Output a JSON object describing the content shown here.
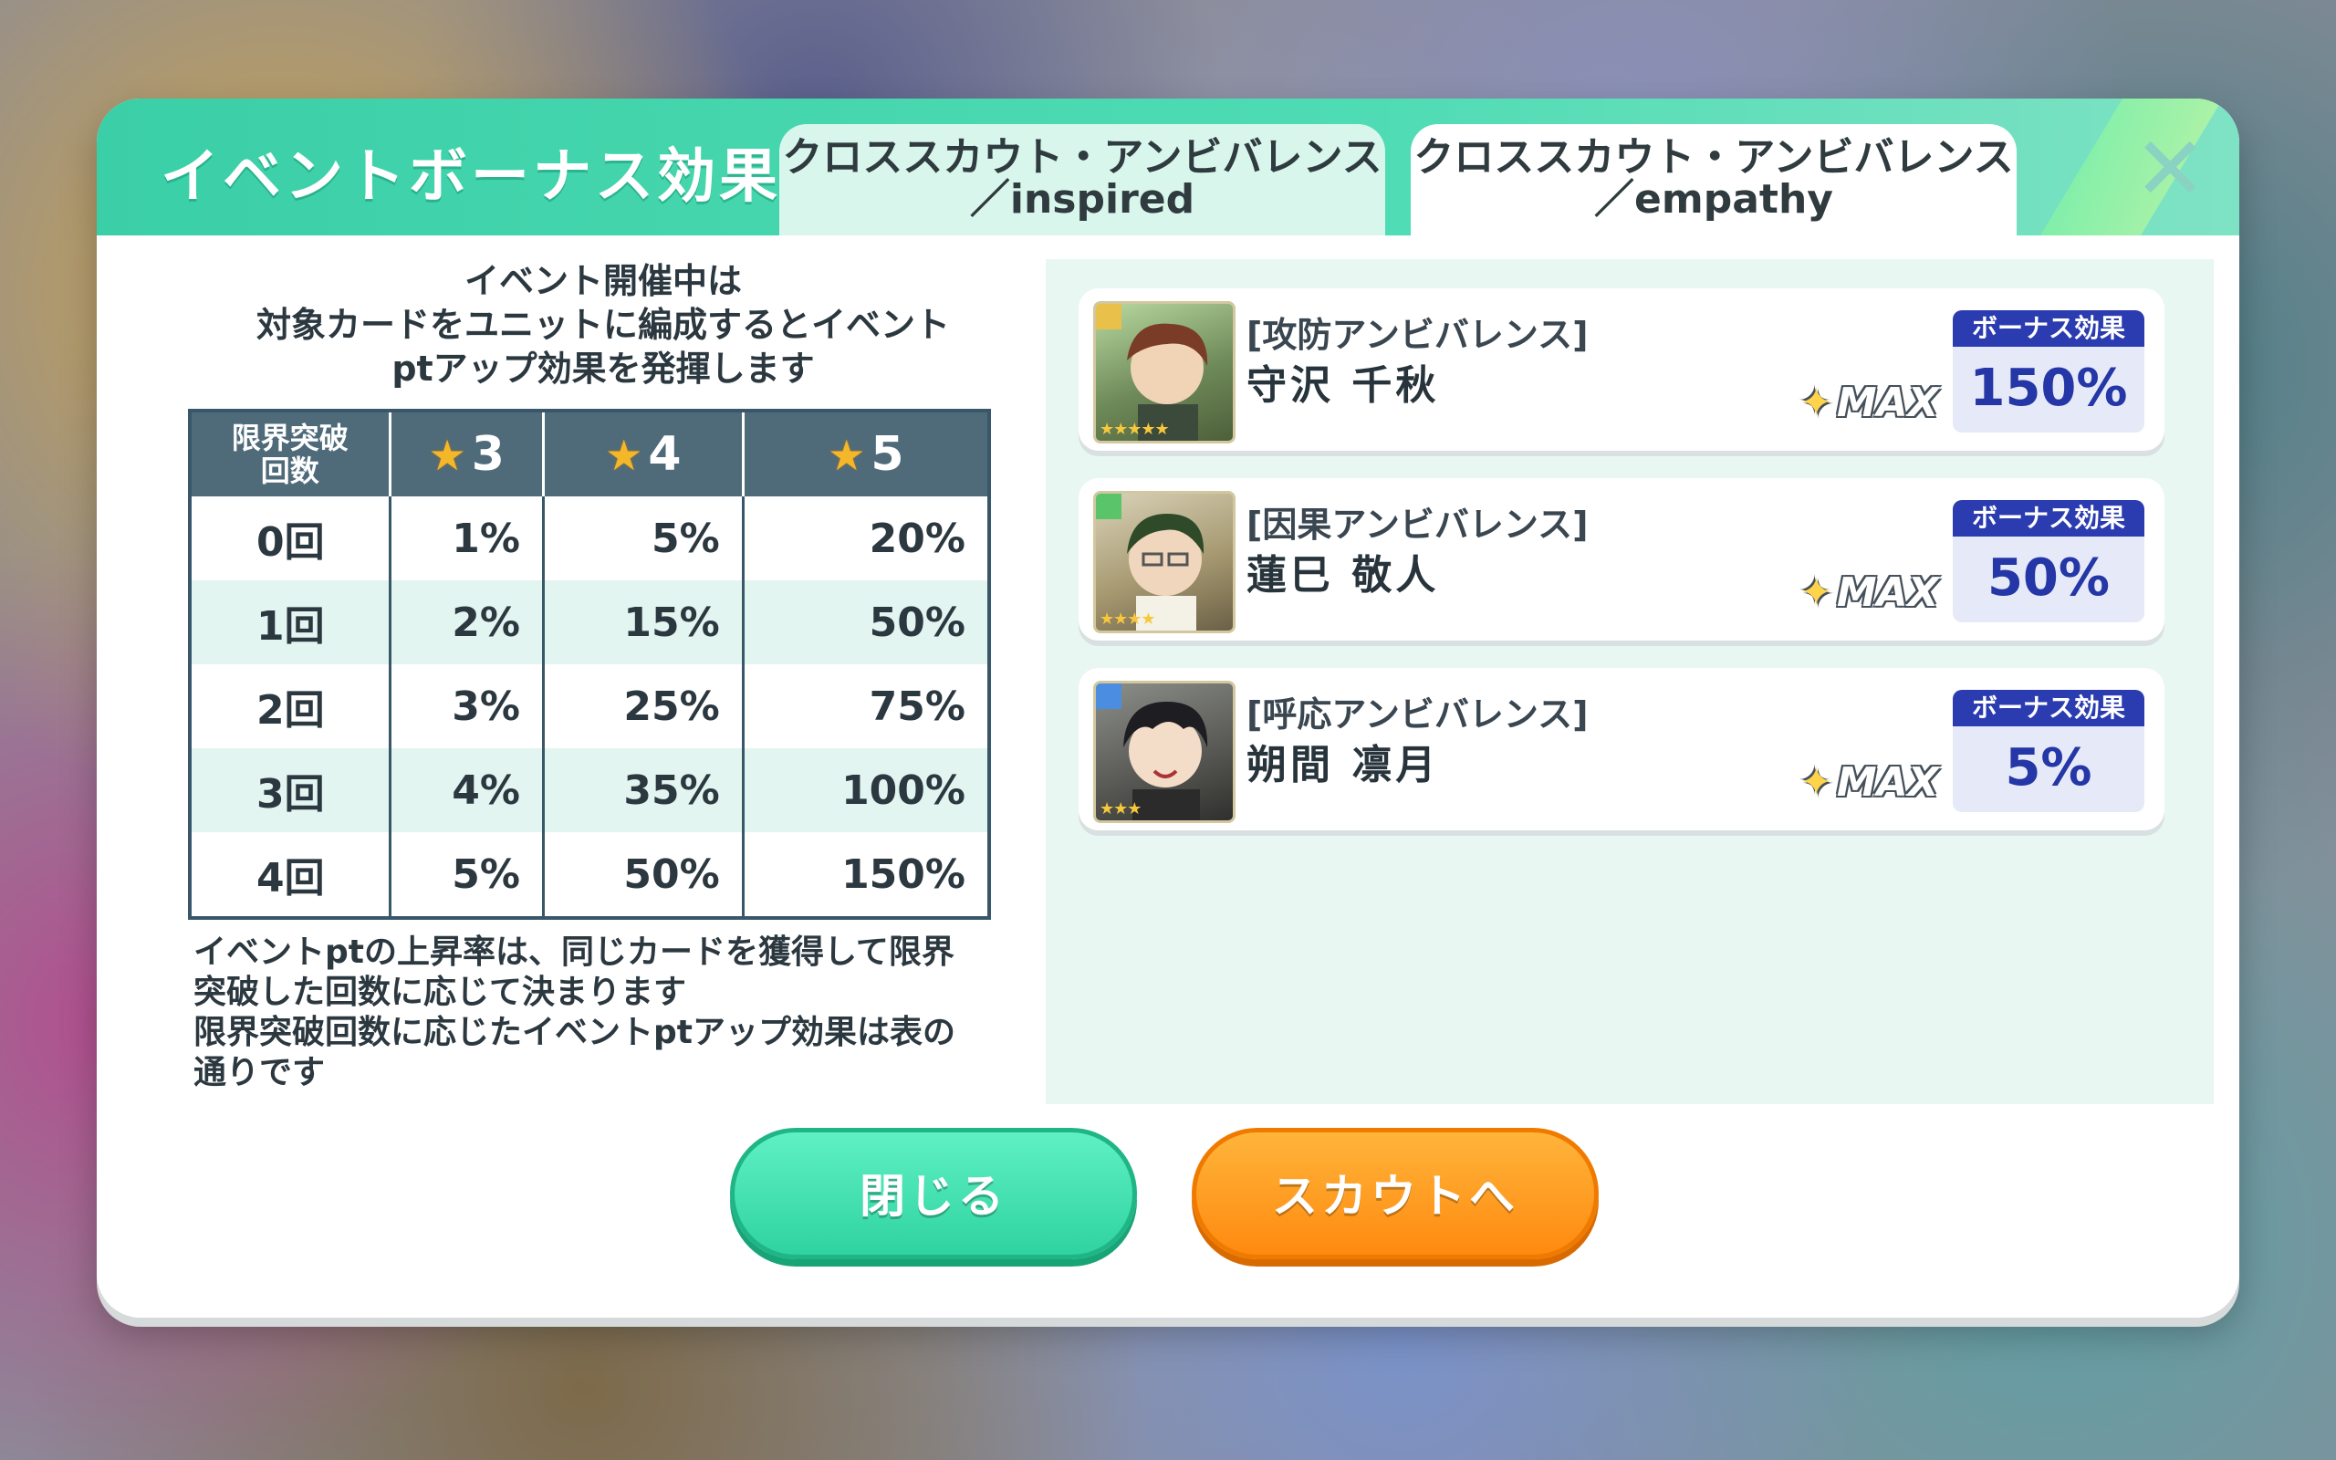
{
  "header": {
    "title": "イベントボーナス効果",
    "tabs": [
      {
        "line1": "クロススカウト・アンビバレンス",
        "line2": "／inspired"
      },
      {
        "line1": "クロススカウト・アンビバレンス",
        "line2": "／empathy"
      }
    ],
    "close_symbol": "✕"
  },
  "intro": {
    "line1": "イベント開催中は",
    "line2": "対象カードをユニットに編成するとイベント",
    "line3": "ptアップ効果を発揮します"
  },
  "table": {
    "header_first_line1": "限界突破",
    "header_first_line2": "回数",
    "columns": [
      "3",
      "4",
      "5"
    ],
    "rows": [
      {
        "label": "0回",
        "values": [
          "1%",
          "5%",
          "20%"
        ]
      },
      {
        "label": "1回",
        "values": [
          "2%",
          "15%",
          "50%"
        ]
      },
      {
        "label": "2回",
        "values": [
          "3%",
          "25%",
          "75%"
        ]
      },
      {
        "label": "3回",
        "values": [
          "4%",
          "35%",
          "100%"
        ]
      },
      {
        "label": "4回",
        "values": [
          "5%",
          "50%",
          "150%"
        ]
      }
    ]
  },
  "note": {
    "line1": "イベントptの上昇率は、同じカードを獲得して限界",
    "line2": "突破した回数に応じて決まります",
    "line3": "限界突破回数に応じたイベントptアップ効果は表の",
    "line4": "通りです"
  },
  "cards": [
    {
      "type": "[攻防アンビバレンス]",
      "name": "守沢 千秋",
      "max": "MAX",
      "badge": "ボーナス効果",
      "bonus": "150%",
      "stars": "★★★★★",
      "color": "#e8c04a"
    },
    {
      "type": "[因果アンビバレンス]",
      "name": "蓮巳 敬人",
      "max": "MAX",
      "badge": "ボーナス効果",
      "bonus": "50%",
      "stars": "★★★★",
      "color": "#59c46a"
    },
    {
      "type": "[呼応アンビバレンス]",
      "name": "朔間 凛月",
      "max": "MAX",
      "badge": "ボーナス効果",
      "bonus": "5%",
      "stars": "★★★",
      "color": "#4b8de0"
    }
  ],
  "buttons": {
    "close": "閉じる",
    "scout": "スカウトへ"
  }
}
